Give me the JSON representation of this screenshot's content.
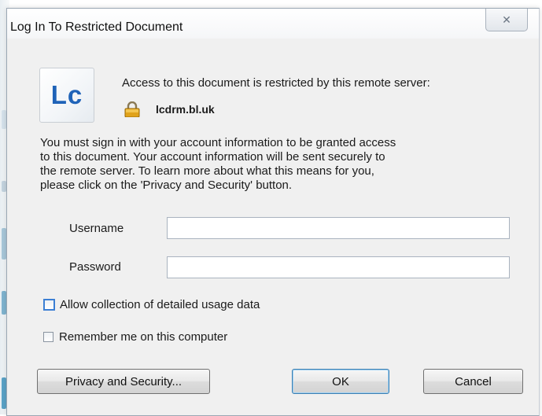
{
  "window": {
    "title": "Log In To Restricted Document",
    "close_icon": "close-icon"
  },
  "header": {
    "logo_text": "Lc",
    "access_message": "Access to this document is restricted by this remote server:",
    "lock_icon": "lock-icon",
    "server": "lcdrm.bl.uk"
  },
  "info_lines": [
    "You must sign in with your account information to be granted access",
    "to this document. Your account information will be sent securely to",
    "the remote server. To learn more about what this means for you,",
    "please click on the 'Privacy and Security' button."
  ],
  "form": {
    "username_label": "Username",
    "username_value": "",
    "password_label": "Password",
    "password_value": ""
  },
  "options": {
    "usage_data_label": "Allow collection of detailed usage data",
    "usage_data_checked": false,
    "remember_label": "Remember me on this computer",
    "remember_checked": false
  },
  "buttons": {
    "privacy": "Privacy and Security...",
    "ok": "OK",
    "cancel": "Cancel"
  },
  "colors": {
    "accent": "#1f63b8",
    "focus": "#3c7fd4"
  }
}
